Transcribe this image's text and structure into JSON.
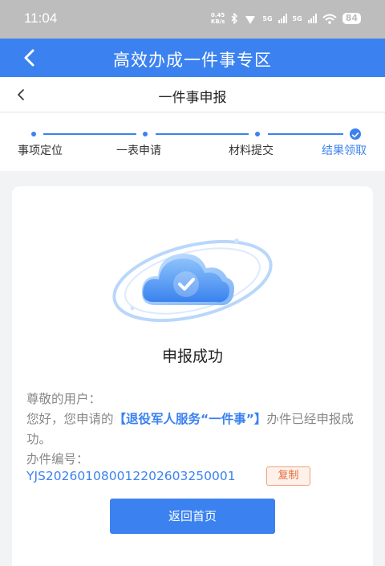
{
  "status_bar": {
    "time": "11:04",
    "net_speed_value": "0.45",
    "net_speed_unit": "KB/s",
    "network_1": "5G",
    "network_2": "5G",
    "battery": "84"
  },
  "app_header": {
    "title": "高效办成一件事专区"
  },
  "sub_header": {
    "title": "一件事申报"
  },
  "steps": [
    {
      "label": "事项定位",
      "state": "done"
    },
    {
      "label": "一表申请",
      "state": "done"
    },
    {
      "label": "材料提交",
      "state": "done"
    },
    {
      "label": "结果领取",
      "state": "current"
    }
  ],
  "result": {
    "title": "申报成功",
    "greeting": "尊敬的用户：",
    "message_prefix": "您好，您申请的",
    "service_name": "【退役军人服务“一件事”】",
    "message_suffix": "办件已经申报成功。",
    "case_number_label": "办件编号：",
    "case_number": "YJS202601080012202603250001",
    "copy_label": "复制",
    "home_button_label": "返回首页"
  },
  "colors": {
    "primary": "#3b82f0",
    "status_bar": "#bdbdbd",
    "copy_border": "#f0a27a",
    "copy_text": "#e56b3c"
  },
  "icons": [
    "back-arrow-icon",
    "bluetooth-icon",
    "signal-icon",
    "wifi-icon",
    "battery-icon",
    "check-icon",
    "cloud-check-icon"
  ]
}
